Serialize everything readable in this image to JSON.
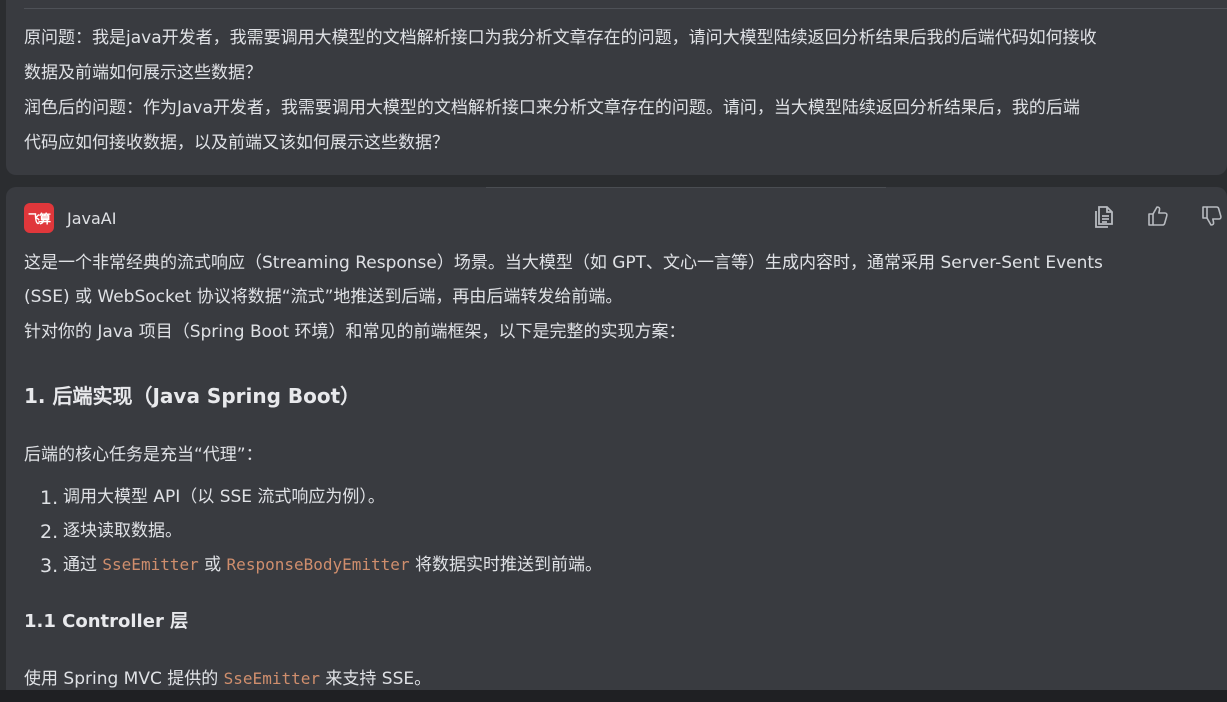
{
  "question": {
    "original_line1": "原问题：我是java开发者，我需要调用大模型的文档解析接口为我分析文章存在的问题，请问大模型陆续返回分析结果后我的后端代码如何接收",
    "original_line2": "数据及前端如何展示这些数据？",
    "refined_line1": "润色后的问题：作为Java开发者，我需要调用大模型的文档解析接口来分析文章存在的问题。请问，当大模型陆续返回分析结果后，我的后端",
    "refined_line2": "代码应如何接收数据，以及前端又该如何展示这些数据？"
  },
  "bot": {
    "logo_text": "飞算",
    "name": "JavaAI"
  },
  "actions": {
    "copy_icon": "copy-icon",
    "like_icon": "thumbs-up-icon",
    "dislike_icon": "thumbs-down-icon"
  },
  "answer": {
    "intro_line1": "这是一个非常经典的流式响应（Streaming Response）场景。当大模型（如 GPT、文心一言等）生成内容时，通常采用 Server-Sent Events",
    "intro_line2": "(SSE) 或 WebSocket 协议将数据“流式”地推送到后端，再由后端转发给前端。",
    "intro_line3": "针对你的 Java 项目（Spring Boot 环境）和常见的前端框架，以下是完整的实现方案：",
    "heading_backend": "1. 后端实现（Java Spring Boot）",
    "core_task": "后端的核心任务是充当“代理”：",
    "steps": [
      {
        "num": "1.",
        "text": "调用大模型 API（以 SSE 流式响应为例）。"
      },
      {
        "num": "2.",
        "text": "逐块读取数据。"
      },
      {
        "num": "3.",
        "prefix": "通过 ",
        "code1": "SseEmitter",
        "middle": " 或 ",
        "code2": "ResponseBodyEmitter",
        "suffix": " 将数据实时推送到前端。"
      }
    ],
    "heading_controller": "1.1 Controller 层",
    "mvc_prefix": "使用 Spring MVC 提供的 ",
    "mvc_code": "SseEmitter",
    "mvc_suffix": " 来支持 SSE。"
  },
  "colors": {
    "background": "#2b2d30",
    "card": "#393b40",
    "text": "#dfe1e5",
    "code": "#cf8e6d",
    "logo": "#e0373b"
  }
}
